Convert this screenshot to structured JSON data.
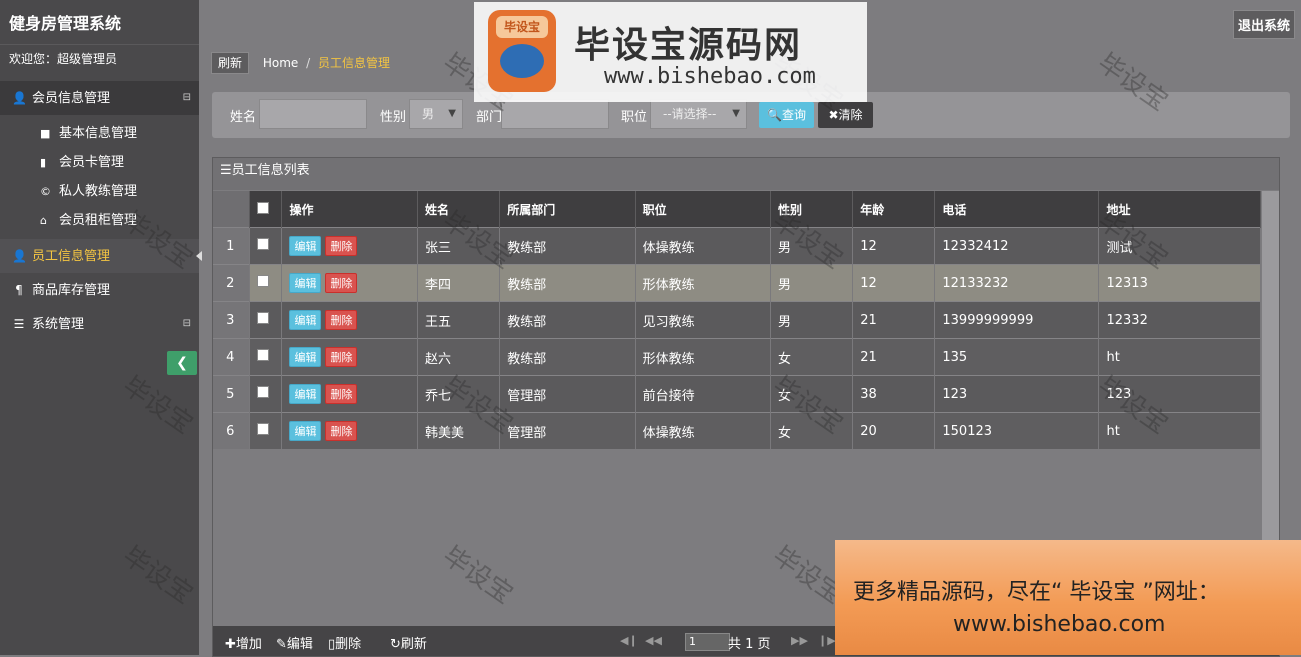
{
  "app": {
    "title": "健身房管理系统",
    "welcome": "欢迎您：超级管理员",
    "logout": "退出系统"
  },
  "sidebar": {
    "groups": [
      {
        "label": "会员信息管理",
        "icon": "user-icon",
        "toggle": "⊟"
      },
      {
        "label": "员工信息管理",
        "icon": "user-icon"
      },
      {
        "label": "商品库存管理",
        "icon": "utensils-icon"
      },
      {
        "label": "系统管理",
        "icon": "list-icon",
        "toggle": "⊟"
      }
    ],
    "sub_items": [
      {
        "label": "基本信息管理",
        "icon": "folder-icon"
      },
      {
        "label": "会员卡管理",
        "icon": "book-icon"
      },
      {
        "label": "私人教练管理",
        "icon": "copyright-icon"
      },
      {
        "label": "会员租柜管理",
        "icon": "home-icon"
      }
    ]
  },
  "breadcrumb": {
    "refresh": "刷新",
    "home": "Home",
    "sep": "/",
    "current": "员工信息管理"
  },
  "filter": {
    "name_label": "姓名",
    "name_value": "",
    "gender_label": "性别",
    "gender_value": "男",
    "dept_label": "部门",
    "dept_value": "",
    "position_label": "职位",
    "position_value": "--请选择--",
    "query": "查询",
    "clear": "清除"
  },
  "panel": {
    "title": "员工信息列表"
  },
  "table": {
    "headers": {
      "ops": "操作",
      "name": "姓名",
      "dept": "所属部门",
      "position": "职位",
      "gender": "性别",
      "age": "年龄",
      "phone": "电话",
      "address": "地址"
    },
    "edit_label": "编辑",
    "delete_label": "删除",
    "rows": [
      {
        "no": "1",
        "name": "张三",
        "dept": "教练部",
        "position": "体操教练",
        "gender": "男",
        "age": "12",
        "phone": "12332412",
        "address": "测试"
      },
      {
        "no": "2",
        "name": "李四",
        "dept": "教练部",
        "position": "形体教练",
        "gender": "男",
        "age": "12",
        "phone": "12133232",
        "address": "12313"
      },
      {
        "no": "3",
        "name": "王五",
        "dept": "教练部",
        "position": "见习教练",
        "gender": "男",
        "age": "21",
        "phone": "13999999999",
        "address": "12332"
      },
      {
        "no": "4",
        "name": "赵六",
        "dept": "教练部",
        "position": "形体教练",
        "gender": "女",
        "age": "21",
        "phone": "135",
        "address": "ht"
      },
      {
        "no": "5",
        "name": "乔七",
        "dept": "管理部",
        "position": "前台接待",
        "gender": "女",
        "age": "38",
        "phone": "123",
        "address": "123"
      },
      {
        "no": "6",
        "name": "韩美美",
        "dept": "管理部",
        "position": "体操教练",
        "gender": "女",
        "age": "20",
        "phone": "150123",
        "address": "ht"
      }
    ]
  },
  "toolbar": {
    "add": "增加",
    "edit": "编辑",
    "delete": "删除",
    "refresh": "刷新",
    "page": "1",
    "total": "共 1 页"
  },
  "watermark": {
    "text": "毕设宝"
  },
  "logo": {
    "badge": "毕设宝",
    "title": "毕设宝源码网",
    "url": "www.bishebao.com"
  },
  "promo": {
    "line1": "更多精品源码，尽在“ 毕设宝 ”网址：",
    "line2": "www.bishebao.com"
  }
}
